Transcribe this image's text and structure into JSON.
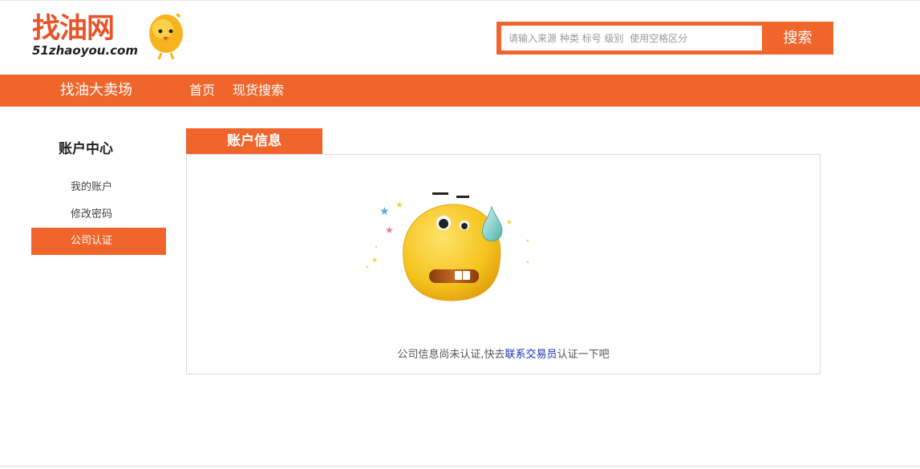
{
  "header": {
    "logo_text": "找油网",
    "logo_domain": "51zhaoyou.com",
    "search_placeholder": "请输入来源 种类 标号 级别  使用空格区分",
    "search_button": "搜索"
  },
  "nav": {
    "brand": "找油大卖场",
    "links": [
      "首页",
      "现货搜索"
    ]
  },
  "sidebar": {
    "title": "账户中心",
    "items": [
      {
        "label": "我的账户",
        "active": false
      },
      {
        "label": "修改密码",
        "active": false
      },
      {
        "label": "公司认证",
        "active": true
      }
    ]
  },
  "main": {
    "tab_title": "账户信息",
    "message_before": "公司信息尚未认证,快去",
    "message_link": "联系交易员",
    "message_after": "认证一下吧"
  },
  "colors": {
    "accent": "#f0652c",
    "link": "#1530b8",
    "emoji_yellow": "#f4c21c"
  }
}
